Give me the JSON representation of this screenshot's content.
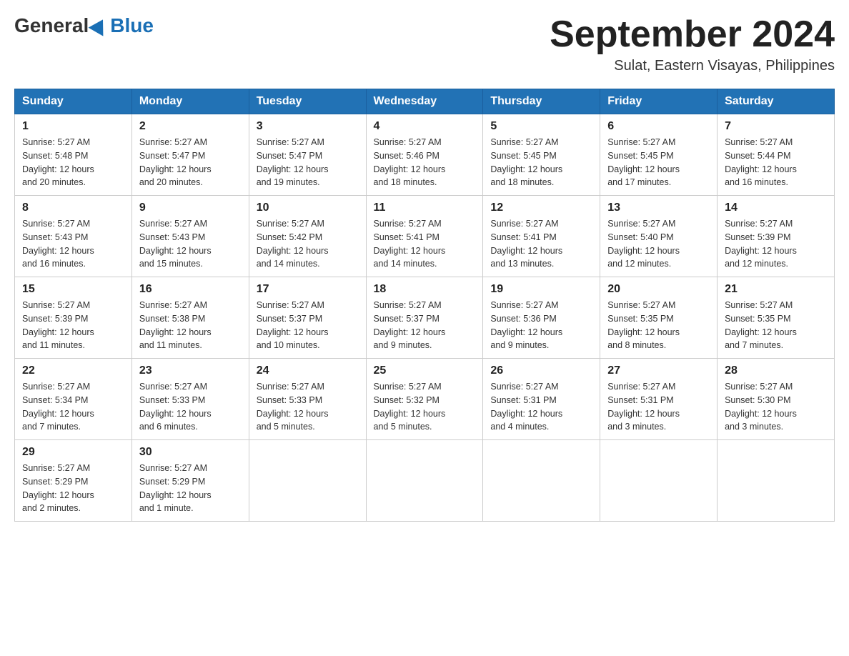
{
  "header": {
    "logo_general": "General",
    "logo_blue": "Blue",
    "month_title": "September 2024",
    "location": "Sulat, Eastern Visayas, Philippines"
  },
  "days_of_week": [
    "Sunday",
    "Monday",
    "Tuesday",
    "Wednesday",
    "Thursday",
    "Friday",
    "Saturday"
  ],
  "weeks": [
    [
      {
        "day": "1",
        "sunrise": "5:27 AM",
        "sunset": "5:48 PM",
        "daylight": "12 hours and 20 minutes."
      },
      {
        "day": "2",
        "sunrise": "5:27 AM",
        "sunset": "5:47 PM",
        "daylight": "12 hours and 20 minutes."
      },
      {
        "day": "3",
        "sunrise": "5:27 AM",
        "sunset": "5:47 PM",
        "daylight": "12 hours and 19 minutes."
      },
      {
        "day": "4",
        "sunrise": "5:27 AM",
        "sunset": "5:46 PM",
        "daylight": "12 hours and 18 minutes."
      },
      {
        "day": "5",
        "sunrise": "5:27 AM",
        "sunset": "5:45 PM",
        "daylight": "12 hours and 18 minutes."
      },
      {
        "day": "6",
        "sunrise": "5:27 AM",
        "sunset": "5:45 PM",
        "daylight": "12 hours and 17 minutes."
      },
      {
        "day": "7",
        "sunrise": "5:27 AM",
        "sunset": "5:44 PM",
        "daylight": "12 hours and 16 minutes."
      }
    ],
    [
      {
        "day": "8",
        "sunrise": "5:27 AM",
        "sunset": "5:43 PM",
        "daylight": "12 hours and 16 minutes."
      },
      {
        "day": "9",
        "sunrise": "5:27 AM",
        "sunset": "5:43 PM",
        "daylight": "12 hours and 15 minutes."
      },
      {
        "day": "10",
        "sunrise": "5:27 AM",
        "sunset": "5:42 PM",
        "daylight": "12 hours and 14 minutes."
      },
      {
        "day": "11",
        "sunrise": "5:27 AM",
        "sunset": "5:41 PM",
        "daylight": "12 hours and 14 minutes."
      },
      {
        "day": "12",
        "sunrise": "5:27 AM",
        "sunset": "5:41 PM",
        "daylight": "12 hours and 13 minutes."
      },
      {
        "day": "13",
        "sunrise": "5:27 AM",
        "sunset": "5:40 PM",
        "daylight": "12 hours and 12 minutes."
      },
      {
        "day": "14",
        "sunrise": "5:27 AM",
        "sunset": "5:39 PM",
        "daylight": "12 hours and 12 minutes."
      }
    ],
    [
      {
        "day": "15",
        "sunrise": "5:27 AM",
        "sunset": "5:39 PM",
        "daylight": "12 hours and 11 minutes."
      },
      {
        "day": "16",
        "sunrise": "5:27 AM",
        "sunset": "5:38 PM",
        "daylight": "12 hours and 11 minutes."
      },
      {
        "day": "17",
        "sunrise": "5:27 AM",
        "sunset": "5:37 PM",
        "daylight": "12 hours and 10 minutes."
      },
      {
        "day": "18",
        "sunrise": "5:27 AM",
        "sunset": "5:37 PM",
        "daylight": "12 hours and 9 minutes."
      },
      {
        "day": "19",
        "sunrise": "5:27 AM",
        "sunset": "5:36 PM",
        "daylight": "12 hours and 9 minutes."
      },
      {
        "day": "20",
        "sunrise": "5:27 AM",
        "sunset": "5:35 PM",
        "daylight": "12 hours and 8 minutes."
      },
      {
        "day": "21",
        "sunrise": "5:27 AM",
        "sunset": "5:35 PM",
        "daylight": "12 hours and 7 minutes."
      }
    ],
    [
      {
        "day": "22",
        "sunrise": "5:27 AM",
        "sunset": "5:34 PM",
        "daylight": "12 hours and 7 minutes."
      },
      {
        "day": "23",
        "sunrise": "5:27 AM",
        "sunset": "5:33 PM",
        "daylight": "12 hours and 6 minutes."
      },
      {
        "day": "24",
        "sunrise": "5:27 AM",
        "sunset": "5:33 PM",
        "daylight": "12 hours and 5 minutes."
      },
      {
        "day": "25",
        "sunrise": "5:27 AM",
        "sunset": "5:32 PM",
        "daylight": "12 hours and 5 minutes."
      },
      {
        "day": "26",
        "sunrise": "5:27 AM",
        "sunset": "5:31 PM",
        "daylight": "12 hours and 4 minutes."
      },
      {
        "day": "27",
        "sunrise": "5:27 AM",
        "sunset": "5:31 PM",
        "daylight": "12 hours and 3 minutes."
      },
      {
        "day": "28",
        "sunrise": "5:27 AM",
        "sunset": "5:30 PM",
        "daylight": "12 hours and 3 minutes."
      }
    ],
    [
      {
        "day": "29",
        "sunrise": "5:27 AM",
        "sunset": "5:29 PM",
        "daylight": "12 hours and 2 minutes."
      },
      {
        "day": "30",
        "sunrise": "5:27 AM",
        "sunset": "5:29 PM",
        "daylight": "12 hours and 1 minute."
      },
      null,
      null,
      null,
      null,
      null
    ]
  ],
  "labels": {
    "sunrise": "Sunrise:",
    "sunset": "Sunset:",
    "daylight": "Daylight:"
  }
}
